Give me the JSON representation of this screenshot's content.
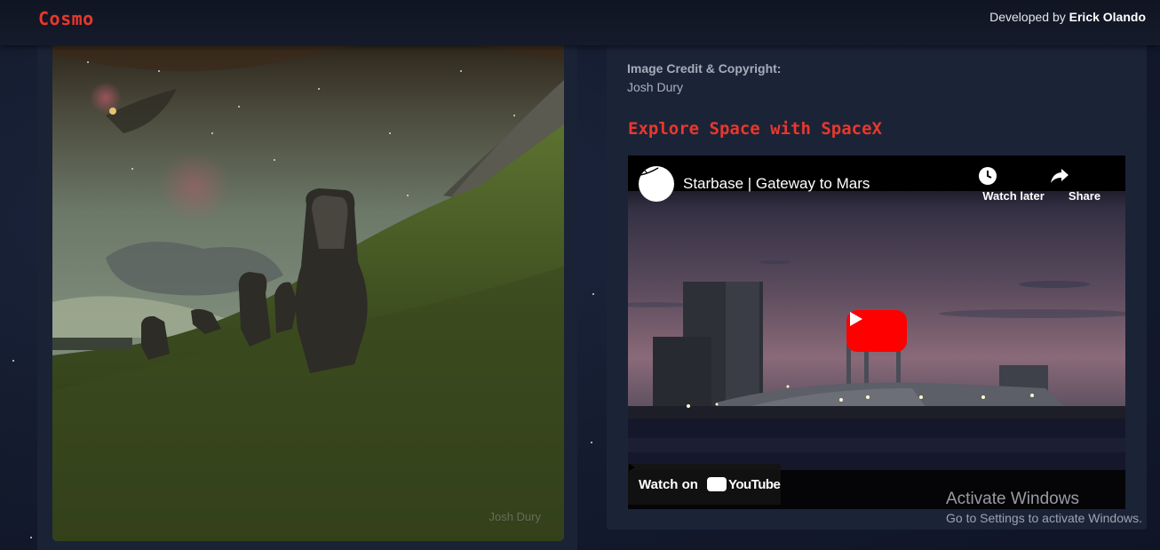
{
  "header": {
    "brand": "Cosmo",
    "developer_prefix": "Developed by",
    "developer_name": "Erick Olando"
  },
  "apod": {
    "photo_watermark": "Josh Dury",
    "credit_label": "Image Credit & Copyright:",
    "credit_name": "Josh Dury"
  },
  "spacex": {
    "heading": "Explore Space with SpaceX",
    "video": {
      "title": "Starbase | Gateway to Mars",
      "watch_later": "Watch later",
      "share": "Share",
      "watch_on": "Watch on",
      "youtube": "YouTube"
    }
  },
  "os_overlay": {
    "line1": "Activate Windows",
    "line2": "Go to Settings to activate Windows."
  },
  "colors": {
    "accent": "#e8382c",
    "background": "#141b2e",
    "card": "#1b2337",
    "youtube_red": "#ff0000"
  }
}
